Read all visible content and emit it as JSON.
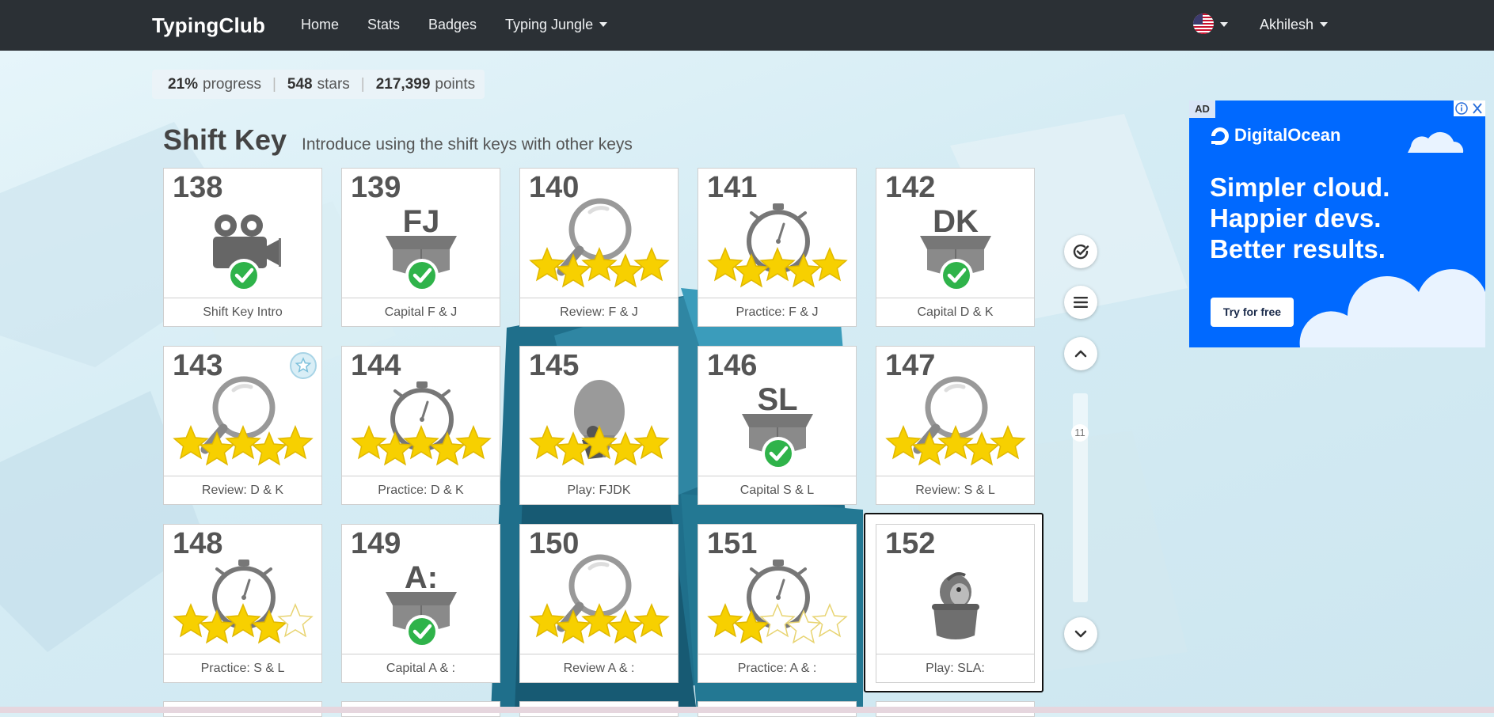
{
  "navbar": {
    "brand": "TypingClub",
    "links": [
      "Home",
      "Stats",
      "Badges",
      "Typing Jungle"
    ],
    "user": "Akhilesh"
  },
  "progress": {
    "percent": "21%",
    "percent_label": "progress",
    "stars": "548",
    "stars_label": "stars",
    "points": "217,399",
    "points_label": "points"
  },
  "section": {
    "title": "Shift Key",
    "subtitle": "Introduce using the shift keys with other keys"
  },
  "lessons": [
    {
      "num": "138",
      "label": "Shift Key Intro",
      "icon": "video-camera-icon",
      "stars": 0,
      "completed": true
    },
    {
      "num": "139",
      "label": "Capital F & J",
      "icon": "open-box-icon",
      "keys": "FJ",
      "stars": 0,
      "completed": true
    },
    {
      "num": "140",
      "label": "Review: F & J",
      "icon": "magnifier-icon",
      "stars": 5
    },
    {
      "num": "141",
      "label": "Practice: F & J",
      "icon": "stopwatch-icon",
      "stars": 5
    },
    {
      "num": "142",
      "label": "Capital D & K",
      "icon": "open-box-icon",
      "keys": "DK",
      "stars": 0,
      "completed": true
    },
    {
      "num": "143",
      "label": "Review: D & K",
      "icon": "magnifier-icon",
      "stars": 5,
      "badge": "star-badge-icon"
    },
    {
      "num": "144",
      "label": "Practice: D & K",
      "icon": "stopwatch-icon",
      "stars": 5
    },
    {
      "num": "145",
      "label": "Play: FJDK",
      "icon": "hot-air-balloon-icon",
      "stars": 5
    },
    {
      "num": "146",
      "label": "Capital S & L",
      "icon": "open-box-icon",
      "keys": "SL",
      "stars": 0,
      "completed": true
    },
    {
      "num": "147",
      "label": "Review: S & L",
      "icon": "magnifier-icon",
      "stars": 5
    },
    {
      "num": "148",
      "label": "Practice: S & L",
      "icon": "stopwatch-icon",
      "stars": 4
    },
    {
      "num": "149",
      "label": "Capital A & :",
      "icon": "open-box-icon",
      "keys": "A:",
      "stars": 0,
      "completed": true
    },
    {
      "num": "150",
      "label": "Review A & :",
      "icon": "magnifier-icon",
      "stars": 5
    },
    {
      "num": "151",
      "label": "Practice: A & :",
      "icon": "stopwatch-icon",
      "stars": 2
    },
    {
      "num": "152",
      "label": "Play: SLA:",
      "icon": "penguin-in-pot-icon",
      "stars": 0,
      "selected": true
    }
  ],
  "side_controls": {
    "scroll_position_label": "11",
    "buttons": [
      "check-circle-icon",
      "list-icon",
      "chevron-up-icon",
      "chevron-down-icon"
    ]
  },
  "ad": {
    "badge": "AD",
    "brand": "DigitalOcean",
    "headline_1": "Simpler cloud.",
    "headline_2": "Happier devs.",
    "headline_3": "Better results.",
    "cta": "Try for free"
  },
  "colors": {
    "navbar": "#2b3035",
    "star": "#f7d000",
    "check": "#2fb34a",
    "ad_bg": "#0069ff"
  }
}
